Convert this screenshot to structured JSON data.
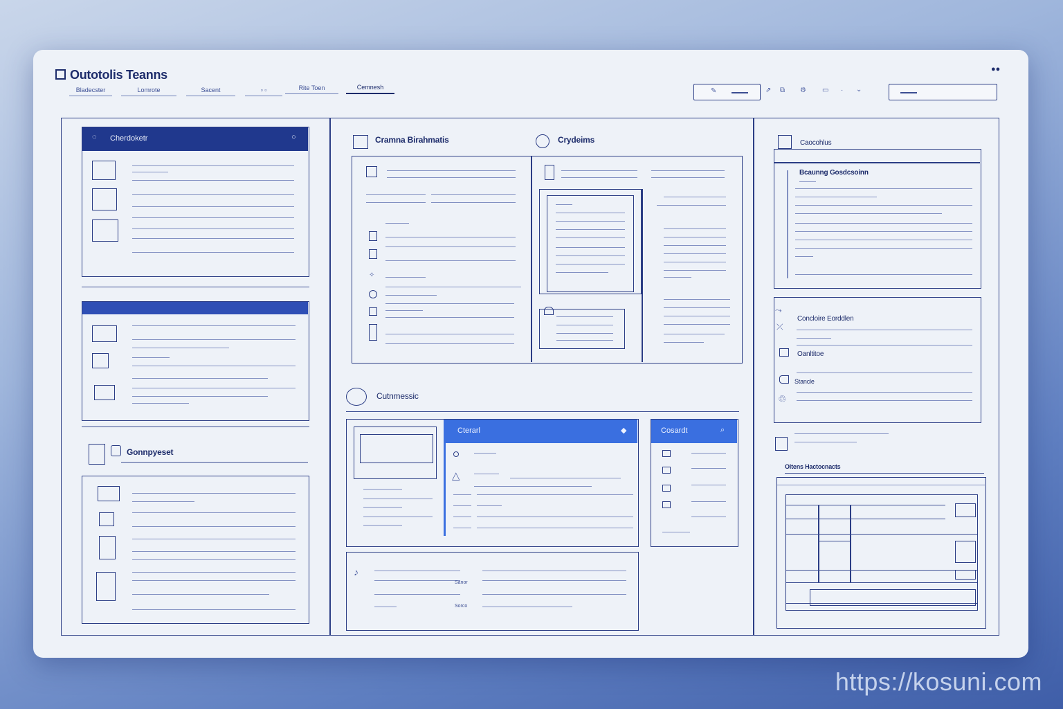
{
  "app": {
    "title": "Outotolis Teanns"
  },
  "nav": {
    "tabs": [
      {
        "label": "Bladecster"
      },
      {
        "label": "Lomrote"
      },
      {
        "label": "Sacent"
      },
      {
        "label": ""
      },
      {
        "label": "Rite Toen"
      },
      {
        "label": "Cemnesh"
      }
    ]
  },
  "toolbar": {
    "icons": [
      "share-icon",
      "copy-icon",
      "gear-icon",
      "panel-icon",
      "dot-icon",
      "chevron-down-icon"
    ]
  },
  "left": {
    "card1": {
      "title": "Cherdoketr"
    },
    "card3": {
      "title": "Gonnpyeset"
    }
  },
  "center": {
    "section1": {
      "title": "Cramna Birahmatis"
    },
    "section2": {
      "title": "Crydeims"
    },
    "section3": {
      "title": "Cutnmessic"
    },
    "card_a": {
      "title": "Cterarl"
    },
    "card_b": {
      "title": "Cosardt"
    },
    "tiny1": "Sanor",
    "tiny2": "Sorco"
  },
  "right": {
    "section1": {
      "title": "Caocohlus"
    },
    "doc": {
      "title": "Bcaunng Gosdcsoinn"
    },
    "list": {
      "items": [
        {
          "label": "Concloire Eorddlen"
        },
        {
          "label": "Oanltitoe"
        },
        {
          "label": "Stancle"
        }
      ]
    },
    "section4": {
      "title": "Oltens Hactocnacts"
    }
  },
  "watermark": "https://kosuni.com"
}
